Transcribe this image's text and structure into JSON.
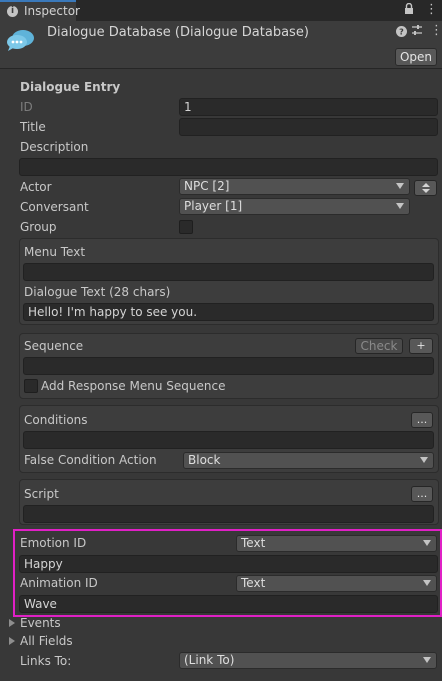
{
  "window": {
    "tab_title": "Inspector"
  },
  "header": {
    "title": "Dialogue Database (Dialogue Database)",
    "open_label": "Open"
  },
  "section": {
    "title": "Dialogue Entry"
  },
  "fields": {
    "id_label": "ID",
    "id_value": "1",
    "title_label": "Title",
    "title_value": "",
    "description_label": "Description",
    "description_value": "",
    "actor_label": "Actor",
    "actor_value": "NPC [2]",
    "conversant_label": "Conversant",
    "conversant_value": "Player [1]",
    "group_label": "Group"
  },
  "text_box": {
    "menu_text_label": "Menu Text",
    "menu_text_value": "",
    "dialogue_text_label": "Dialogue Text (28 chars)",
    "dialogue_text_value": "Hello! I'm happy to see you."
  },
  "sequence_box": {
    "label": "Sequence",
    "check_label": "Check",
    "add_label": "+",
    "value": "",
    "add_response_label": "Add Response Menu Sequence"
  },
  "conditions_box": {
    "label": "Conditions",
    "more_label": "...",
    "value": "",
    "false_action_label": "False Condition Action",
    "false_action_value": "Block"
  },
  "script_box": {
    "label": "Script",
    "more_label": "...",
    "value": ""
  },
  "custom_fields": {
    "emotion_label": "Emotion ID",
    "emotion_type": "Text",
    "emotion_value": "Happy",
    "animation_label": "Animation ID",
    "animation_type": "Text",
    "animation_value": "Wave"
  },
  "foldouts": {
    "events": "Events",
    "all_fields": "All Fields"
  },
  "links": {
    "label": "Links To:",
    "value": "(Link To)"
  },
  "colors": {
    "background": "#383838",
    "field": "#2a2a2a",
    "highlight": "#e020c6",
    "tab_accent": "#3a79bb"
  }
}
